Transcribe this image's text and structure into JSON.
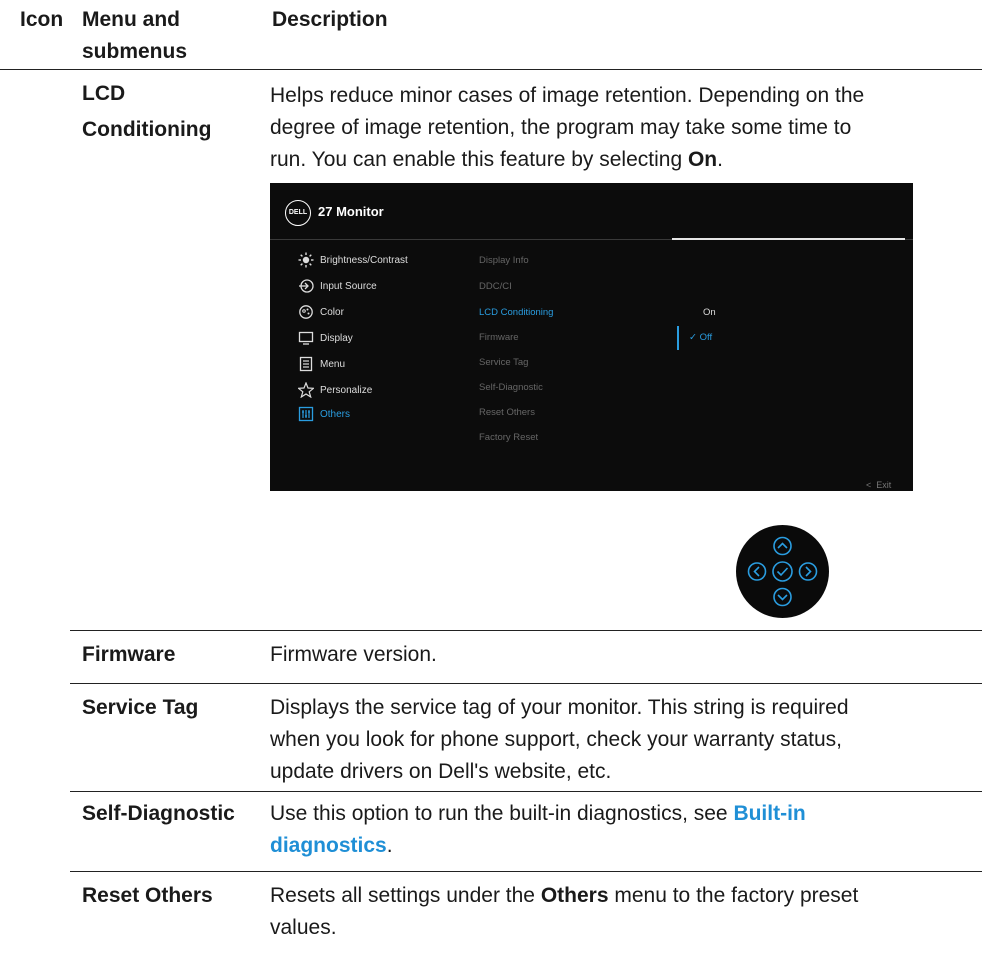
{
  "header": {
    "col_icon": "Icon",
    "col_menu_line1": "Menu and",
    "col_menu_line2": "submenus",
    "col_desc": "Description"
  },
  "lcd": {
    "label_line1": "LCD",
    "label_line2": "Conditioning",
    "desc_line1": "Helps reduce minor cases of image retention. Depending on the",
    "desc_line2": "degree of image retention, the program may take some time to",
    "desc_line3_pre": "run. You can enable this feature by selecting ",
    "desc_line3_bold": "On",
    "desc_line3_post": "."
  },
  "osd": {
    "logo": "DELL",
    "title": "27 Monitor",
    "menu_items": [
      {
        "label": "Brightness/Contrast",
        "icon": "brightness-icon"
      },
      {
        "label": "Input Source",
        "icon": "input-source-icon"
      },
      {
        "label": "Color",
        "icon": "color-icon"
      },
      {
        "label": "Display",
        "icon": "display-icon"
      },
      {
        "label": "Menu",
        "icon": "menu-icon"
      },
      {
        "label": "Personalize",
        "icon": "star-icon"
      },
      {
        "label": "Others",
        "icon": "others-icon"
      }
    ],
    "submenu_items": [
      "Display Info",
      "DDC/CI",
      "LCD Conditioning",
      "Firmware",
      "Service Tag",
      "Self-Diagnostic",
      "Reset Others",
      "Factory Reset"
    ],
    "options": {
      "on": "On",
      "off": "Off"
    },
    "exit_label": "Exit",
    "accent_color": "#2a9de0"
  },
  "rows": {
    "firmware": {
      "label": "Firmware",
      "desc": "Firmware version."
    },
    "service_tag": {
      "label": "Service Tag",
      "desc_line1": "Displays the service tag of your monitor. This string is required",
      "desc_line2": "when you look for phone support, check your warranty status,",
      "desc_line3": "update drivers on Dell's website, etc."
    },
    "self_diag": {
      "label": "Self-Diagnostic",
      "desc_line1_pre": "Use this option to run the built-in diagnostics, see ",
      "link_line1": "Built-in",
      "link_line2": "diagnostics",
      "desc_line2_post": "."
    },
    "reset_others": {
      "label": "Reset Others",
      "desc_line1_pre": "Resets all settings under the ",
      "desc_line1_bold": "Others",
      "desc_line1_post": " menu to the factory preset",
      "desc_line2": "values."
    }
  },
  "link_color": "#1f8fd6"
}
